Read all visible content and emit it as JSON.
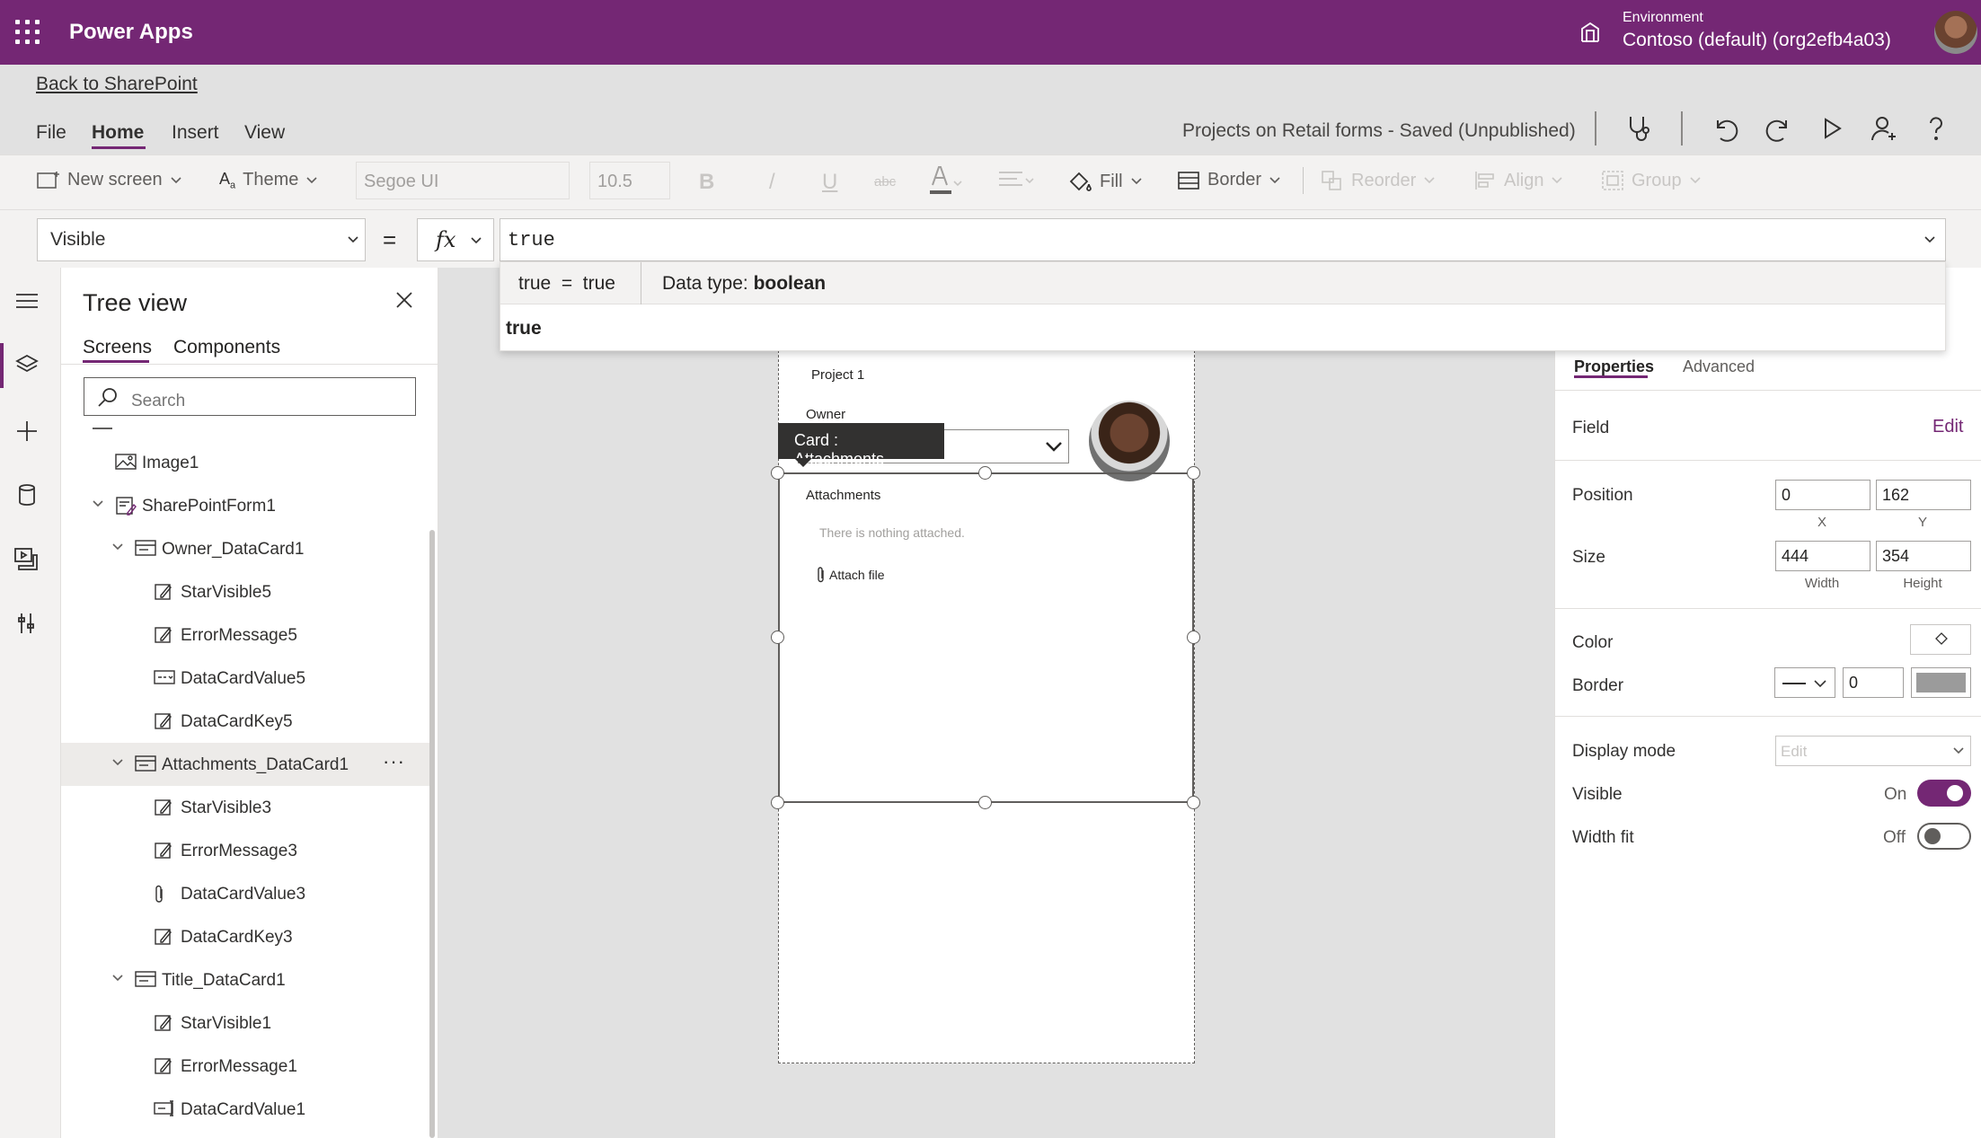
{
  "topbar": {
    "app_name": "Power Apps",
    "environment_label": "Environment",
    "environment_value": "Contoso (default) (org2efb4a03)",
    "brand_color": "#742774"
  },
  "back_link": "Back to SharePoint",
  "menu": {
    "items": [
      "File",
      "Home",
      "Insert",
      "View"
    ],
    "active": "Home"
  },
  "save_status": "Projects on Retail forms - Saved (Unpublished)",
  "toolbar_icons": [
    "stethoscope-icon",
    "undo-icon",
    "redo-icon",
    "play-icon",
    "share-user-icon",
    "help-icon"
  ],
  "ribbon": {
    "new_screen": "New screen",
    "theme": "Theme",
    "font": "Segoe UI",
    "font_size": "10.5",
    "bold": "B",
    "italic": "/",
    "underline": "U",
    "strike": "abc",
    "fill": "Fill",
    "border": "Border",
    "reorder": "Reorder",
    "align": "Align",
    "group": "Group"
  },
  "formula_bar": {
    "property": "Visible",
    "equals": "=",
    "fx": "fx",
    "formula": "true",
    "eval_lhs": "true",
    "eval_op": "=",
    "eval_rhs": "true",
    "data_type_label": "Data type:",
    "data_type_value": "boolean",
    "suggestion": "true"
  },
  "tree": {
    "title": "Tree view",
    "tabs": [
      "Screens",
      "Components"
    ],
    "active_tab": "Screens",
    "search_placeholder": "Search",
    "nodes": [
      {
        "label": "Image1",
        "level": 1,
        "icon": "image-icon",
        "expander": false
      },
      {
        "label": "SharePointForm1",
        "level": 1,
        "icon": "form-icon",
        "expander": true
      },
      {
        "label": "Owner_DataCard1",
        "level": 2,
        "icon": "card-icon",
        "expander": true
      },
      {
        "label": "StarVisible5",
        "level": 3,
        "icon": "edit-label-icon",
        "expander": false
      },
      {
        "label": "ErrorMessage5",
        "level": 3,
        "icon": "edit-label-icon",
        "expander": false
      },
      {
        "label": "DataCardValue5",
        "level": 3,
        "icon": "combobox-icon",
        "expander": false
      },
      {
        "label": "DataCardKey5",
        "level": 3,
        "icon": "edit-label-icon",
        "expander": false
      },
      {
        "label": "Attachments_DataCard1",
        "level": 2,
        "icon": "card-icon",
        "expander": true,
        "selected": true
      },
      {
        "label": "StarVisible3",
        "level": 3,
        "icon": "edit-label-icon",
        "expander": false
      },
      {
        "label": "ErrorMessage3",
        "level": 3,
        "icon": "edit-label-icon",
        "expander": false
      },
      {
        "label": "DataCardValue3",
        "level": 3,
        "icon": "attachment-icon",
        "expander": false
      },
      {
        "label": "DataCardKey3",
        "level": 3,
        "icon": "edit-label-icon",
        "expander": false
      },
      {
        "label": "Title_DataCard1",
        "level": 2,
        "icon": "card-icon",
        "expander": true
      },
      {
        "label": "StarVisible1",
        "level": 3,
        "icon": "edit-label-icon",
        "expander": false
      },
      {
        "label": "ErrorMessage1",
        "level": 3,
        "icon": "edit-label-icon",
        "expander": false
      },
      {
        "label": "DataCardValue1",
        "level": 3,
        "icon": "textinput-icon",
        "expander": false
      }
    ],
    "more": "···"
  },
  "canvas": {
    "project_label": "Project 1",
    "owner_label": "Owner",
    "tooltip": "Card : Attachments",
    "attachments_label": "Attachments",
    "attachments_empty": "There is nothing attached.",
    "attach_file": "Attach file"
  },
  "props": {
    "tabs": [
      "Properties",
      "Advanced"
    ],
    "active_tab": "Properties",
    "field_label": "Field",
    "field_action": "Edit",
    "position_label": "Position",
    "x": "0",
    "y": "162",
    "x_label": "X",
    "y_label": "Y",
    "size_label": "Size",
    "width": "444",
    "height": "354",
    "width_label": "Width",
    "height_label": "Height",
    "color_label": "Color",
    "border_label": "Border",
    "border_width": "0",
    "border_color": "#9b9b9b",
    "display_mode_label": "Display mode",
    "display_mode": "Edit",
    "visible_label": "Visible",
    "visible_state": "On",
    "visible": true,
    "width_fit_label": "Width fit",
    "width_fit_state": "Off",
    "width_fit": false
  }
}
